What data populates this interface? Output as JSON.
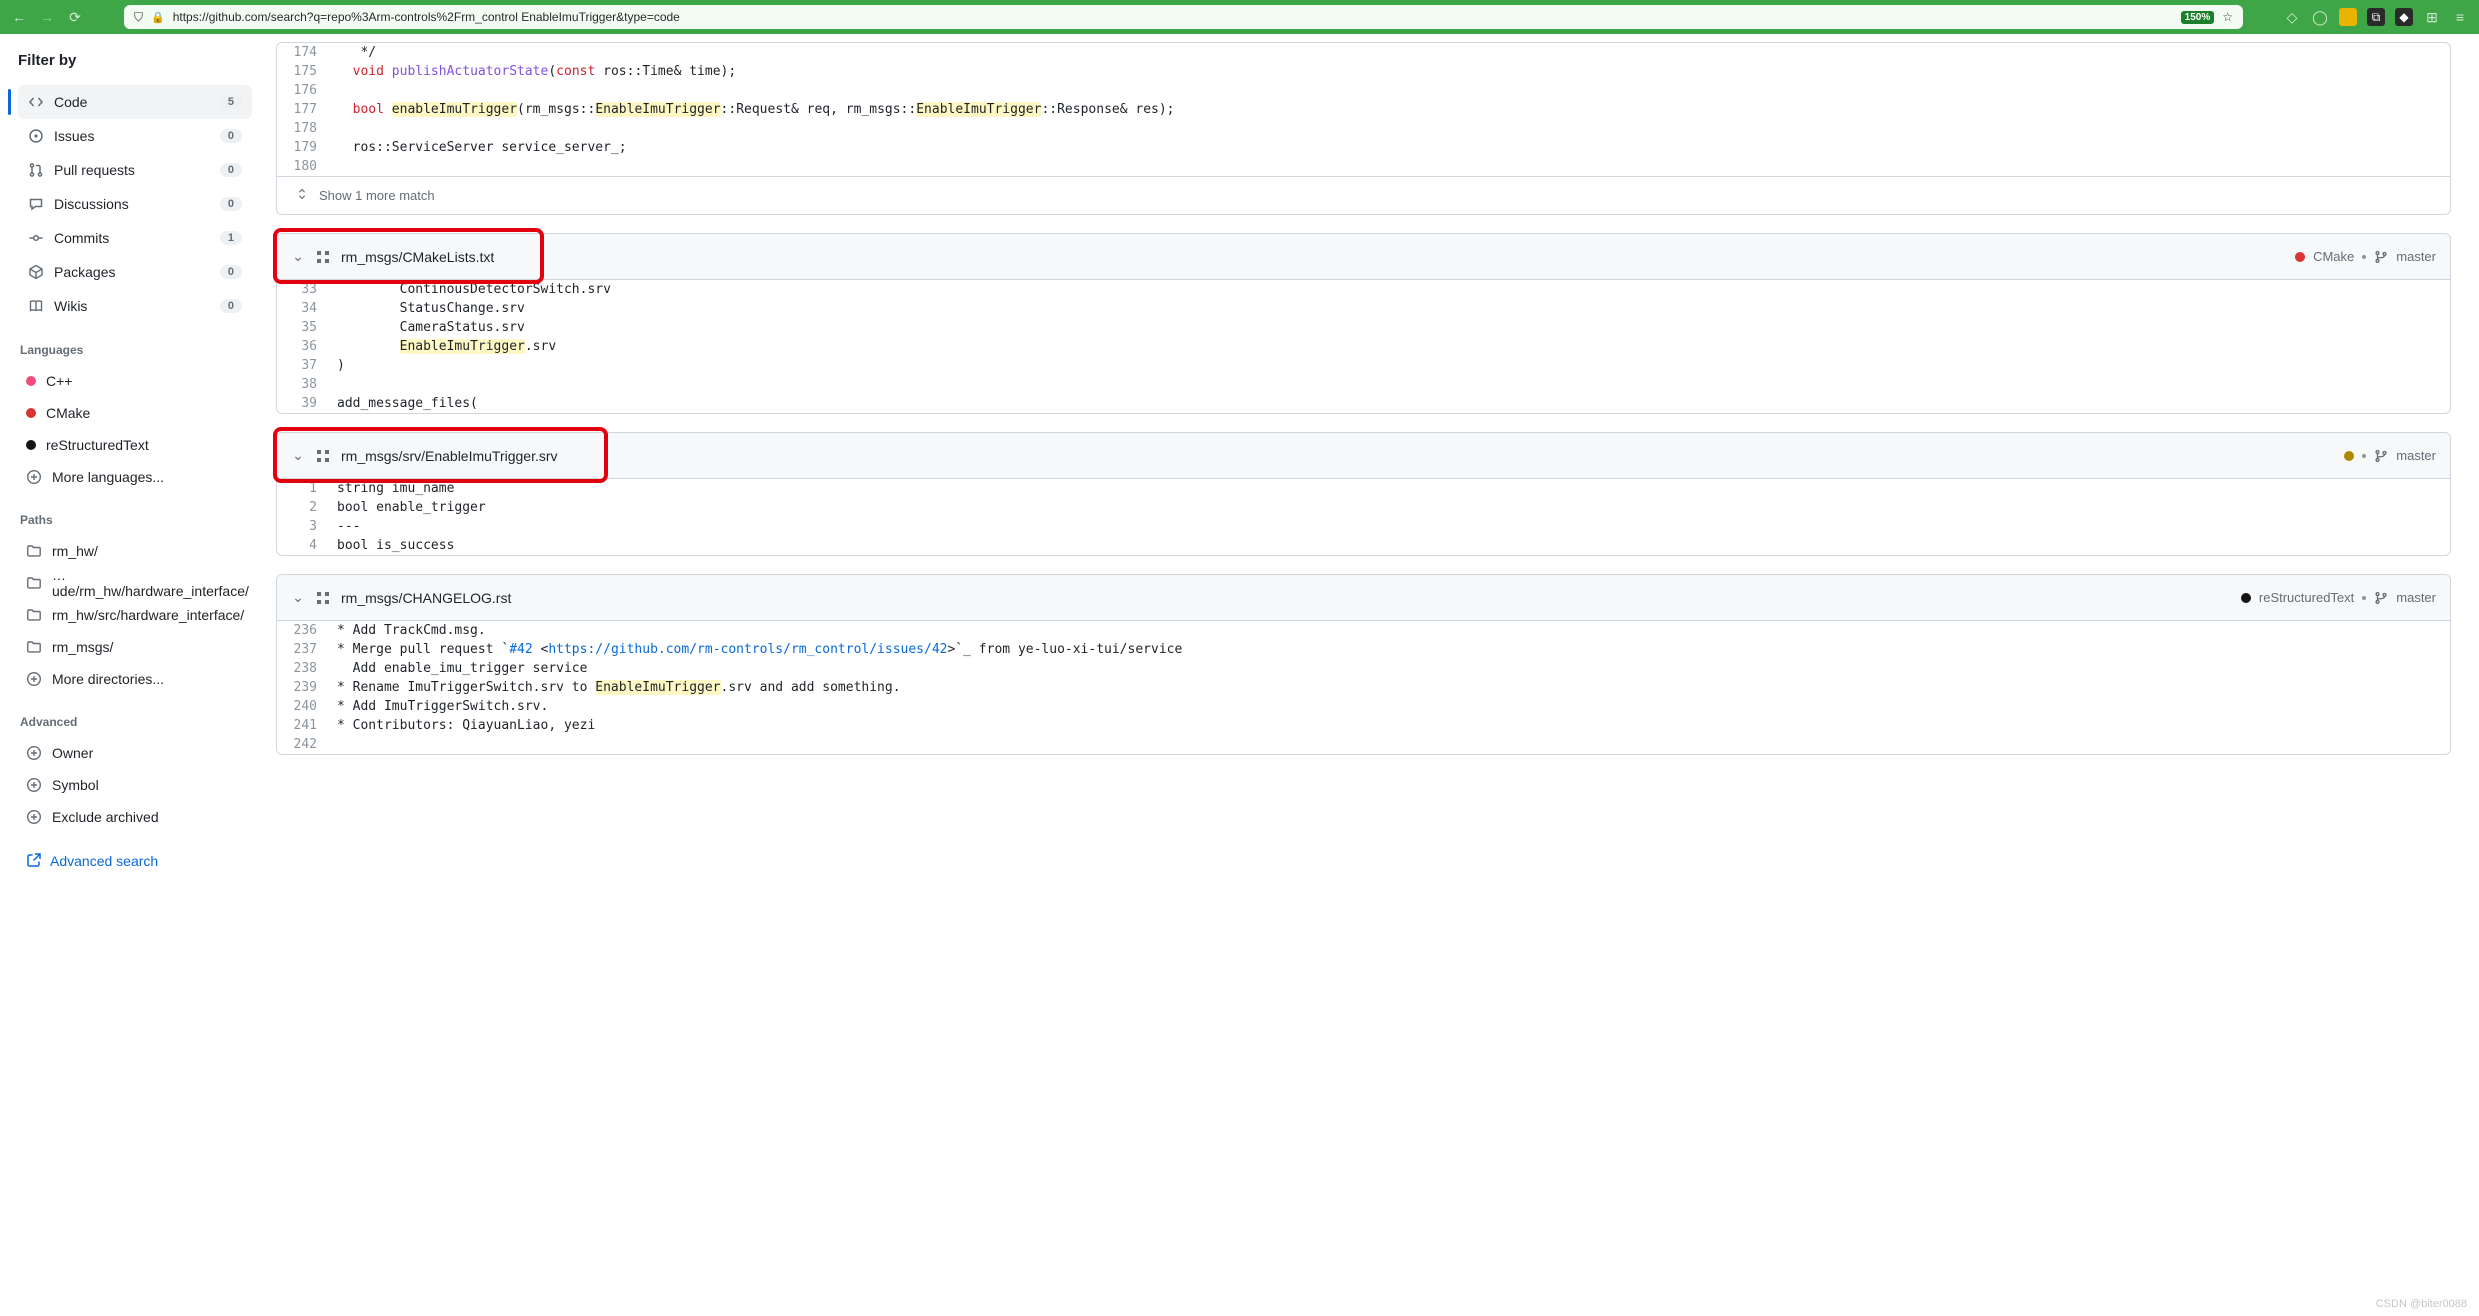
{
  "browser": {
    "url": "https://github.com/search?q=repo%3Arm-controls%2Frm_control EnableImuTrigger&type=code",
    "zoom": "150%"
  },
  "sidebar": {
    "title": "Filter by",
    "filters": [
      {
        "icon": "code",
        "label": "Code",
        "count": "5",
        "active": true
      },
      {
        "icon": "issue",
        "label": "Issues",
        "count": "0",
        "active": false
      },
      {
        "icon": "pr",
        "label": "Pull requests",
        "count": "0",
        "active": false
      },
      {
        "icon": "disc",
        "label": "Discussions",
        "count": "0",
        "active": false
      },
      {
        "icon": "commit",
        "label": "Commits",
        "count": "1",
        "active": false
      },
      {
        "icon": "pkg",
        "label": "Packages",
        "count": "0",
        "active": false
      },
      {
        "icon": "wiki",
        "label": "Wikis",
        "count": "0",
        "active": false
      }
    ],
    "languages_title": "Languages",
    "languages": [
      {
        "name": "C++",
        "color": "#f34b7d"
      },
      {
        "name": "CMake",
        "color": "#da3434"
      },
      {
        "name": "reStructuredText",
        "color": "#141414"
      }
    ],
    "more_languages": "More languages...",
    "paths_title": "Paths",
    "paths": [
      "rm_hw/",
      "…ude/rm_hw/hardware_interface/",
      "rm_hw/src/hardware_interface/",
      "rm_msgs/"
    ],
    "more_directories": "More directories...",
    "advanced_title": "Advanced",
    "advanced": [
      "Owner",
      "Symbol",
      "Exclude archived"
    ],
    "advanced_search": "Advanced search"
  },
  "result0": {
    "show_more": "Show 1 more match",
    "lines": [
      {
        "n": "174",
        "html": "   */"
      },
      {
        "n": "175",
        "html": "  <span class=\"kw\">void</span> <span class=\"fn\">publishActuatorState</span>(<span class=\"kw\">const</span> ros::Time&amp; time);"
      },
      {
        "n": "176",
        "html": ""
      },
      {
        "n": "177",
        "html": "  <span class=\"kw\">bool</span> <span class=\"hl\">enableImuTrigger</span>(rm_msgs::<span class=\"hl\">EnableImuTrigger</span>::Request&amp; req, rm_msgs::<span class=\"hl\">EnableImuTrigger</span>::Response&amp; res);"
      },
      {
        "n": "178",
        "html": ""
      },
      {
        "n": "179",
        "html": "  ros::ServiceServer service_server_;"
      },
      {
        "n": "180",
        "html": ""
      }
    ]
  },
  "result1": {
    "path": "rm_msgs/CMakeLists.txt",
    "lang": "CMake",
    "lang_color": "#da3434",
    "branch": "master",
    "lines": [
      {
        "n": "33",
        "html": "        ContinousDetectorSwitch.srv"
      },
      {
        "n": "34",
        "html": "        StatusChange.srv"
      },
      {
        "n": "35",
        "html": "        CameraStatus.srv"
      },
      {
        "n": "36",
        "html": "        <span class=\"hl\">EnableImuTrigger</span>.srv"
      },
      {
        "n": "37",
        "html": ")"
      },
      {
        "n": "38",
        "html": ""
      },
      {
        "n": "39",
        "html": "add_message_files("
      }
    ]
  },
  "result2": {
    "path": "rm_msgs/srv/EnableImuTrigger.srv",
    "lang": "",
    "lang_color": "#b08800",
    "branch": "master",
    "lines": [
      {
        "n": "1",
        "html": "string imu_name"
      },
      {
        "n": "2",
        "html": "bool enable_trigger"
      },
      {
        "n": "3",
        "html": "---"
      },
      {
        "n": "4",
        "html": "bool is_success"
      }
    ]
  },
  "result3": {
    "path": "rm_msgs/CHANGELOG.rst",
    "lang": "reStructuredText",
    "lang_color": "#141414",
    "branch": "master",
    "lines": [
      {
        "n": "236",
        "html": "* Add TrackCmd.msg."
      },
      {
        "n": "237",
        "html": "* Merge pull request `<span class=\"lnk\">#42</span> &lt;<span class=\"lnk\">https://github.com/rm-controls/rm_control/issues/42</span>&gt;`_ from ye-luo-xi-tui/service"
      },
      {
        "n": "238",
        "html": "  Add enable_imu_trigger service"
      },
      {
        "n": "239",
        "html": "* Rename ImuTriggerSwitch.srv to <span class=\"hl\">EnableImuTrigger</span>.srv and add something."
      },
      {
        "n": "240",
        "html": "* Add ImuTriggerSwitch.srv."
      },
      {
        "n": "241",
        "html": "* Contributors: QiayuanLiao, yezi"
      },
      {
        "n": "242",
        "html": ""
      }
    ]
  },
  "watermark": "CSDN @biter0088"
}
